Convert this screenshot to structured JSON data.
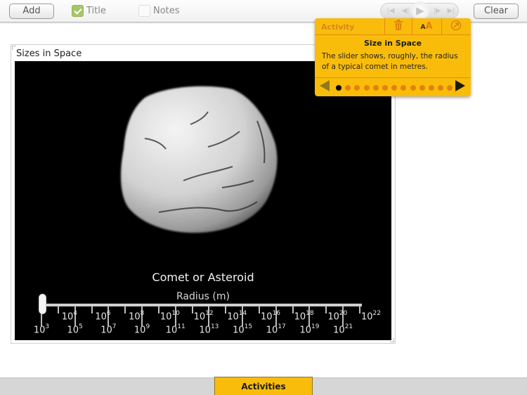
{
  "toolbar": {
    "add_label": "Add",
    "title_label": "Title",
    "title_checked": true,
    "notes_label": "Notes",
    "notes_checked": false,
    "clear_label": "Clear",
    "transport": [
      {
        "name": "first-icon",
        "glyph": "|◀"
      },
      {
        "name": "step-back-icon",
        "glyph": "◀|"
      },
      {
        "name": "play-icon",
        "glyph": "▶"
      },
      {
        "name": "step-forward-icon",
        "glyph": "|▶"
      },
      {
        "name": "last-icon",
        "glyph": "▶|"
      }
    ]
  },
  "panel": {
    "title": "Sizes in Space",
    "caption": "Comet or Asteroid",
    "axis_label": "Radius (m)",
    "slider_value_exponent": 3,
    "scale_min_exponent": 3,
    "scale_max_exponent": 22,
    "ticks_upper": [
      "4",
      "6",
      "8",
      "10",
      "12",
      "14",
      "16",
      "18",
      "20",
      "22"
    ],
    "ticks_lower": [
      "3",
      "5",
      "7",
      "9",
      "11",
      "13",
      "15",
      "17",
      "19",
      "21"
    ],
    "tick_base": "10"
  },
  "popover": {
    "header_label": "Activity",
    "icons": {
      "delete": "trash-icon",
      "text_size": "text-size-icon",
      "link": "go-icon"
    },
    "text_size_glyph": "AA",
    "title": "Size in Space",
    "text": "The slider shows, roughly, the radius of a typical comet in metres.",
    "page_count": 13,
    "current_page": 1
  },
  "bottom": {
    "activities_label": "Activities"
  },
  "colors": {
    "accent": "#f9bc0b",
    "accent_line": "#e88a0a",
    "check_green": "#a7c66a"
  }
}
